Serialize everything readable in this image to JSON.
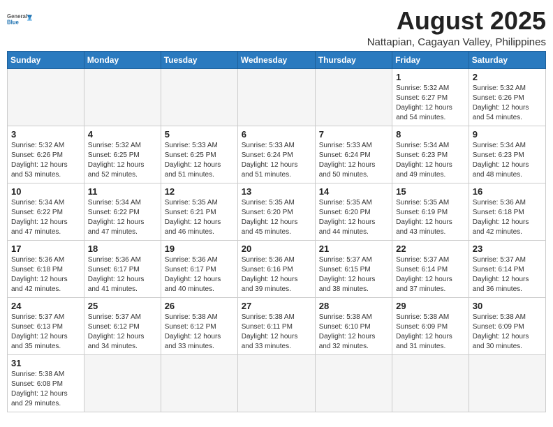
{
  "header": {
    "logo_line1": "General",
    "logo_line2": "Blue",
    "month_year": "August 2025",
    "location": "Nattapian, Cagayan Valley, Philippines"
  },
  "days_of_week": [
    "Sunday",
    "Monday",
    "Tuesday",
    "Wednesday",
    "Thursday",
    "Friday",
    "Saturday"
  ],
  "weeks": [
    [
      {
        "day": "",
        "info": "",
        "empty": true
      },
      {
        "day": "",
        "info": "",
        "empty": true
      },
      {
        "day": "",
        "info": "",
        "empty": true
      },
      {
        "day": "",
        "info": "",
        "empty": true
      },
      {
        "day": "",
        "info": "",
        "empty": true
      },
      {
        "day": "1",
        "info": "Sunrise: 5:32 AM\nSunset: 6:27 PM\nDaylight: 12 hours\nand 54 minutes."
      },
      {
        "day": "2",
        "info": "Sunrise: 5:32 AM\nSunset: 6:26 PM\nDaylight: 12 hours\nand 54 minutes."
      }
    ],
    [
      {
        "day": "3",
        "info": "Sunrise: 5:32 AM\nSunset: 6:26 PM\nDaylight: 12 hours\nand 53 minutes."
      },
      {
        "day": "4",
        "info": "Sunrise: 5:32 AM\nSunset: 6:25 PM\nDaylight: 12 hours\nand 52 minutes."
      },
      {
        "day": "5",
        "info": "Sunrise: 5:33 AM\nSunset: 6:25 PM\nDaylight: 12 hours\nand 51 minutes."
      },
      {
        "day": "6",
        "info": "Sunrise: 5:33 AM\nSunset: 6:24 PM\nDaylight: 12 hours\nand 51 minutes."
      },
      {
        "day": "7",
        "info": "Sunrise: 5:33 AM\nSunset: 6:24 PM\nDaylight: 12 hours\nand 50 minutes."
      },
      {
        "day": "8",
        "info": "Sunrise: 5:34 AM\nSunset: 6:23 PM\nDaylight: 12 hours\nand 49 minutes."
      },
      {
        "day": "9",
        "info": "Sunrise: 5:34 AM\nSunset: 6:23 PM\nDaylight: 12 hours\nand 48 minutes."
      }
    ],
    [
      {
        "day": "10",
        "info": "Sunrise: 5:34 AM\nSunset: 6:22 PM\nDaylight: 12 hours\nand 47 minutes."
      },
      {
        "day": "11",
        "info": "Sunrise: 5:34 AM\nSunset: 6:22 PM\nDaylight: 12 hours\nand 47 minutes."
      },
      {
        "day": "12",
        "info": "Sunrise: 5:35 AM\nSunset: 6:21 PM\nDaylight: 12 hours\nand 46 minutes."
      },
      {
        "day": "13",
        "info": "Sunrise: 5:35 AM\nSunset: 6:20 PM\nDaylight: 12 hours\nand 45 minutes."
      },
      {
        "day": "14",
        "info": "Sunrise: 5:35 AM\nSunset: 6:20 PM\nDaylight: 12 hours\nand 44 minutes."
      },
      {
        "day": "15",
        "info": "Sunrise: 5:35 AM\nSunset: 6:19 PM\nDaylight: 12 hours\nand 43 minutes."
      },
      {
        "day": "16",
        "info": "Sunrise: 5:36 AM\nSunset: 6:18 PM\nDaylight: 12 hours\nand 42 minutes."
      }
    ],
    [
      {
        "day": "17",
        "info": "Sunrise: 5:36 AM\nSunset: 6:18 PM\nDaylight: 12 hours\nand 42 minutes."
      },
      {
        "day": "18",
        "info": "Sunrise: 5:36 AM\nSunset: 6:17 PM\nDaylight: 12 hours\nand 41 minutes."
      },
      {
        "day": "19",
        "info": "Sunrise: 5:36 AM\nSunset: 6:17 PM\nDaylight: 12 hours\nand 40 minutes."
      },
      {
        "day": "20",
        "info": "Sunrise: 5:36 AM\nSunset: 6:16 PM\nDaylight: 12 hours\nand 39 minutes."
      },
      {
        "day": "21",
        "info": "Sunrise: 5:37 AM\nSunset: 6:15 PM\nDaylight: 12 hours\nand 38 minutes."
      },
      {
        "day": "22",
        "info": "Sunrise: 5:37 AM\nSunset: 6:14 PM\nDaylight: 12 hours\nand 37 minutes."
      },
      {
        "day": "23",
        "info": "Sunrise: 5:37 AM\nSunset: 6:14 PM\nDaylight: 12 hours\nand 36 minutes."
      }
    ],
    [
      {
        "day": "24",
        "info": "Sunrise: 5:37 AM\nSunset: 6:13 PM\nDaylight: 12 hours\nand 35 minutes."
      },
      {
        "day": "25",
        "info": "Sunrise: 5:37 AM\nSunset: 6:12 PM\nDaylight: 12 hours\nand 34 minutes."
      },
      {
        "day": "26",
        "info": "Sunrise: 5:38 AM\nSunset: 6:12 PM\nDaylight: 12 hours\nand 33 minutes."
      },
      {
        "day": "27",
        "info": "Sunrise: 5:38 AM\nSunset: 6:11 PM\nDaylight: 12 hours\nand 33 minutes."
      },
      {
        "day": "28",
        "info": "Sunrise: 5:38 AM\nSunset: 6:10 PM\nDaylight: 12 hours\nand 32 minutes."
      },
      {
        "day": "29",
        "info": "Sunrise: 5:38 AM\nSunset: 6:09 PM\nDaylight: 12 hours\nand 31 minutes."
      },
      {
        "day": "30",
        "info": "Sunrise: 5:38 AM\nSunset: 6:09 PM\nDaylight: 12 hours\nand 30 minutes."
      }
    ],
    [
      {
        "day": "31",
        "info": "Sunrise: 5:38 AM\nSunset: 6:08 PM\nDaylight: 12 hours\nand 29 minutes."
      },
      {
        "day": "",
        "info": "",
        "empty": true
      },
      {
        "day": "",
        "info": "",
        "empty": true
      },
      {
        "day": "",
        "info": "",
        "empty": true
      },
      {
        "day": "",
        "info": "",
        "empty": true
      },
      {
        "day": "",
        "info": "",
        "empty": true
      },
      {
        "day": "",
        "info": "",
        "empty": true
      }
    ]
  ]
}
